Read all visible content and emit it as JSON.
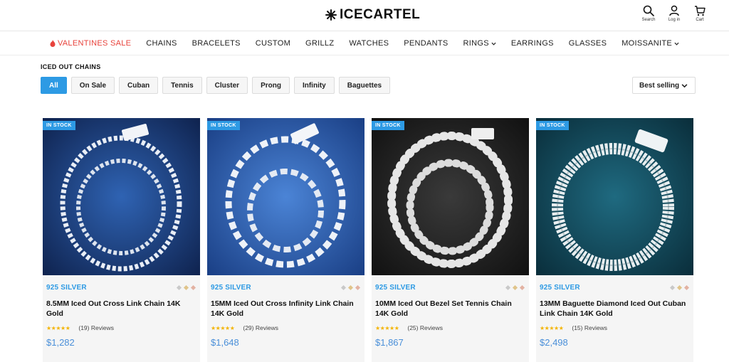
{
  "header": {
    "brand": "ICECARTEL",
    "icons": [
      {
        "name": "search-icon",
        "label": "Search"
      },
      {
        "name": "user-icon",
        "label": "Log in"
      },
      {
        "name": "cart-icon",
        "label": "Cart"
      }
    ]
  },
  "nav": {
    "items": [
      {
        "label": "VALENTINES SALE",
        "sale": true,
        "icon": "flame-icon"
      },
      {
        "label": "CHAINS"
      },
      {
        "label": "BRACELETS"
      },
      {
        "label": "CUSTOM"
      },
      {
        "label": "GRILLZ"
      },
      {
        "label": "WATCHES"
      },
      {
        "label": "PENDANTS"
      },
      {
        "label": "RINGS",
        "dropdown": true
      },
      {
        "label": "EARRINGS"
      },
      {
        "label": "GLASSES"
      },
      {
        "label": "MOISSANITE",
        "dropdown": true
      }
    ]
  },
  "collection": {
    "title": "ICED OUT CHAINS",
    "filters": [
      "All",
      "On Sale",
      "Cuban",
      "Tennis",
      "Cluster",
      "Prong",
      "Infinity",
      "Baguettes"
    ],
    "active_filter": "All",
    "sort_label": "Best selling"
  },
  "colors": {
    "accent": "#2d9ae4",
    "sale": "#e8423b",
    "price": "#4a8fd9",
    "star": "#f4b400"
  },
  "products": [
    {
      "badge": "IN STOCK",
      "material": "925 SILVER",
      "title": "8.5MM Iced Out Cross Link Chain 14K Gold",
      "rating_stars": "★★★★★",
      "reviews": "(19) Reviews",
      "price": "$1,282",
      "image_bg": "#1c3f7a"
    },
    {
      "badge": "IN STOCK",
      "material": "925 SILVER",
      "title": "15MM Iced Out Cross Infinity Link Chain 14K Gold",
      "rating_stars": "★★★★★",
      "reviews": "(29) Reviews",
      "price": "$1,648",
      "image_bg": "#2a5aa8"
    },
    {
      "badge": "IN STOCK",
      "material": "925 SILVER",
      "title": "10MM Iced Out Bezel Set Tennis Chain 14K Gold",
      "rating_stars": "★★★★★",
      "reviews": "(25) Reviews",
      "price": "$1,867",
      "image_bg": "#1e1e1e"
    },
    {
      "badge": "IN STOCK",
      "material": "925 SILVER",
      "title": "13MM Baguette Diamond Iced Out Cuban Link Chain 14K Gold",
      "rating_stars": "★★★★★",
      "reviews": "(15) Reviews",
      "price": "$2,498",
      "image_bg": "#10485a"
    }
  ]
}
